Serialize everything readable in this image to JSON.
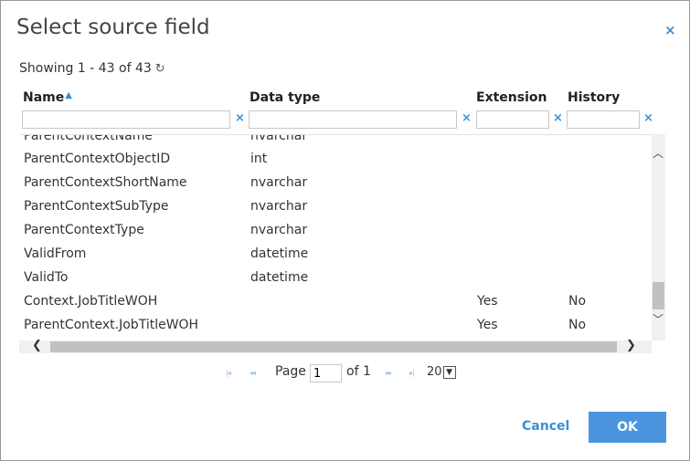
{
  "dialog": {
    "title": "Select source field",
    "close_glyph": "×",
    "showing_text": "Showing 1 - 43 of 43",
    "refresh_glyph": "↻"
  },
  "grid": {
    "columns": [
      {
        "label": "Name",
        "sorted": "ascending"
      },
      {
        "label": "Data type"
      },
      {
        "label": "Extension"
      },
      {
        "label": "History"
      }
    ],
    "clear_glyph": "×",
    "filters": [
      "",
      "",
      "",
      ""
    ],
    "partial_row": {
      "name": "ParentContextName",
      "type": "nvarchar"
    },
    "rows": [
      {
        "name": "ParentContextObjectID",
        "type": "int",
        "extension": "",
        "history": ""
      },
      {
        "name": "ParentContextShortName",
        "type": "nvarchar",
        "extension": "",
        "history": ""
      },
      {
        "name": "ParentContextSubType",
        "type": "nvarchar",
        "extension": "",
        "history": ""
      },
      {
        "name": "ParentContextType",
        "type": "nvarchar",
        "extension": "",
        "history": ""
      },
      {
        "name": "ValidFrom",
        "type": "datetime",
        "extension": "",
        "history": ""
      },
      {
        "name": "ValidTo",
        "type": "datetime",
        "extension": "",
        "history": ""
      },
      {
        "name": "Context.JobTitleWOH",
        "type": "",
        "extension": "Yes",
        "history": "No"
      },
      {
        "name": "ParentContext.JobTitleWOH",
        "type": "",
        "extension": "Yes",
        "history": "No"
      }
    ]
  },
  "pager": {
    "page_label": "Page",
    "page_value": "1",
    "of_label": "of 1",
    "page_size": "20",
    "first_glyph": "|◂",
    "prev_glyph": "◂◂",
    "next_glyph": "▸▸",
    "last_glyph": "▸|"
  },
  "buttons": {
    "cancel": "Cancel",
    "ok": "OK"
  },
  "colors": {
    "accent": "#3a8fd6",
    "ok_button": "#4a95de"
  }
}
